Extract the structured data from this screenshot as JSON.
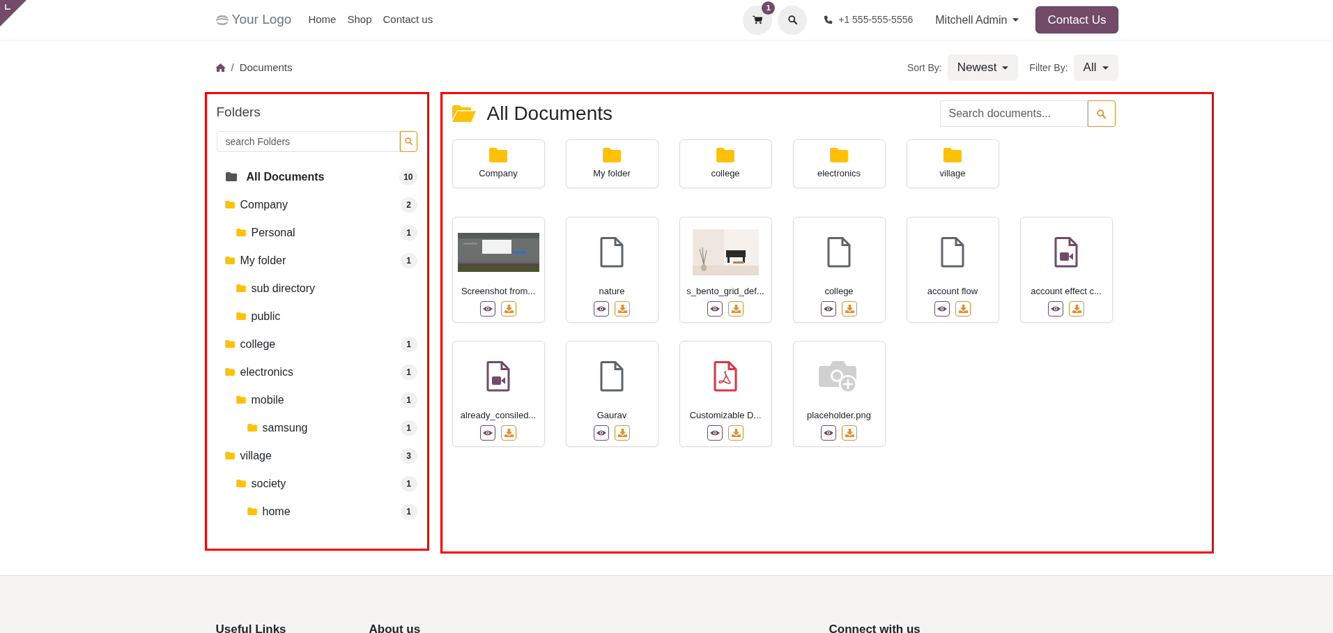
{
  "header": {
    "logo": "Your Logo",
    "nav": [
      {
        "label": "Home"
      },
      {
        "label": "Shop"
      },
      {
        "label": "Contact us"
      }
    ],
    "cart_count": "1",
    "phone": "+1 555-555-5556",
    "user": "Mitchell Admin",
    "cta": "Contact Us"
  },
  "breadcrumb": {
    "separator": "/",
    "current": "Documents"
  },
  "sort": {
    "label": "Sort By:",
    "value": "Newest"
  },
  "filter": {
    "label": "Filter By:",
    "value": "All"
  },
  "folders_panel": {
    "title": "Folders",
    "search_placeholder": "search Folders",
    "tree": [
      {
        "label": "All Documents",
        "count": "10",
        "selected": true
      },
      {
        "label": "Company",
        "count": "2",
        "selected": false,
        "children": [
          {
            "label": "Personal",
            "count": "1",
            "selected": false
          }
        ]
      },
      {
        "label": "My folder",
        "count": "1",
        "selected": false,
        "children": [
          {
            "label": "sub directory",
            "selected": false
          },
          {
            "label": "public",
            "selected": false
          }
        ]
      },
      {
        "label": "college",
        "count": "1",
        "selected": false
      },
      {
        "label": "electronics",
        "count": "1",
        "selected": false,
        "children": [
          {
            "label": "mobile",
            "count": "1",
            "selected": false,
            "children": [
              {
                "label": "samsung",
                "count": "1",
                "selected": false
              }
            ]
          }
        ]
      },
      {
        "label": "village",
        "count": "3",
        "selected": false,
        "children": [
          {
            "label": "society",
            "count": "1",
            "selected": false,
            "children": [
              {
                "label": "home",
                "count": "1",
                "selected": false
              }
            ]
          }
        ]
      }
    ]
  },
  "documents_panel": {
    "title": "All Documents",
    "search_placeholder": "Search documents...",
    "folders": [
      {
        "label": "Company"
      },
      {
        "label": "My folder"
      },
      {
        "label": "college"
      },
      {
        "label": "electronics"
      },
      {
        "label": "village"
      }
    ],
    "documents": [
      {
        "name": "Screenshot from...",
        "kind": "picture"
      },
      {
        "name": "nature",
        "kind": "file"
      },
      {
        "name": "s_bento_grid_def...",
        "kind": "picture"
      },
      {
        "name": "college",
        "kind": "file"
      },
      {
        "name": "account flow",
        "kind": "file"
      },
      {
        "name": "account effect c...",
        "kind": "video"
      },
      {
        "name": "already_consiled...",
        "kind": "video"
      },
      {
        "name": "Gaurav",
        "kind": "file"
      },
      {
        "name": "Customizable D...",
        "kind": "pdf"
      },
      {
        "name": "placeholder.png",
        "kind": "placeholder"
      }
    ]
  },
  "footer": {
    "headings": [
      {
        "label": "Useful Links"
      },
      {
        "label": "About us"
      },
      {
        "label": "Connect with us"
      }
    ]
  }
}
